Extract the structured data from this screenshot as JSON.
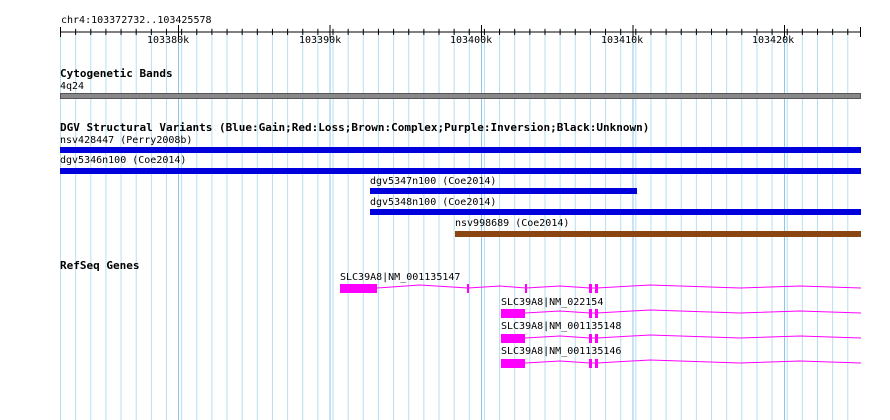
{
  "ruler": {
    "location": "chr4:103372732..103425578",
    "ticks": [
      "103380k",
      "103390k",
      "103400k",
      "103410k",
      "103420k"
    ]
  },
  "cytobands": {
    "title": "Cytogenetic Bands",
    "band": "4q24"
  },
  "dgv": {
    "title": "DGV Structural Variants (Blue:Gain;Red:Loss;Brown:Complex;Purple:Inversion;Black:Unknown)",
    "features": [
      {
        "label": "nsv428447 (Perry2008b)",
        "type": "Gain",
        "color": "#0000dd"
      },
      {
        "label": "dgv5346n100 (Coe2014)",
        "type": "Gain",
        "color": "#0000dd"
      },
      {
        "label": "dgv5347n100 (Coe2014)",
        "type": "Gain",
        "color": "#0000dd"
      },
      {
        "label": "dgv5348n100 (Coe2014)",
        "type": "Gain",
        "color": "#0000dd"
      },
      {
        "label": "nsv998689 (Coe2014)",
        "type": "Complex",
        "color": "#8b4513"
      }
    ]
  },
  "refseq": {
    "title": "RefSeq Genes",
    "color": "#ff00ff",
    "transcripts": [
      {
        "label": "SLC39A8|NM_001135147"
      },
      {
        "label": "SLC39A8|NM_022154"
      },
      {
        "label": "SLC39A8|NM_001135148"
      },
      {
        "label": "SLC39A8|NM_001135146"
      }
    ]
  }
}
